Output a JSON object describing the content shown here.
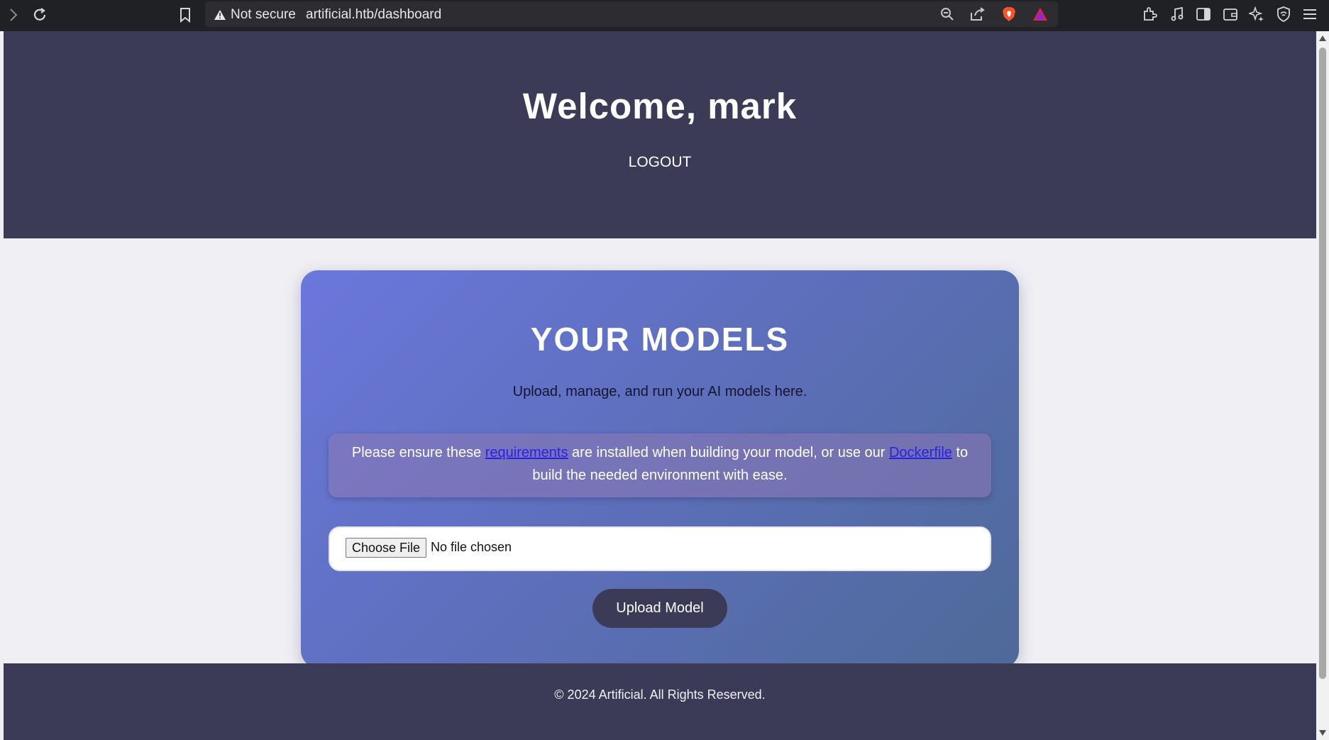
{
  "browser": {
    "security_label": "Not secure",
    "url": "artificial.htb/dashboard",
    "icons": [
      "forward-icon",
      "reload-icon",
      "bookmark-icon",
      "warning-icon",
      "zoom-icon",
      "share-icon",
      "brave-shield-icon",
      "brave-rewards-icon",
      "extensions-icon",
      "media-icon",
      "sidebar-icon",
      "wallet-icon",
      "leo-ai-icon",
      "vpn-icon",
      "menu-icon"
    ]
  },
  "header": {
    "title": "Welcome, mark",
    "logout_label": "LOGOUT"
  },
  "card": {
    "title": "YOUR MODELS",
    "subtitle": "Upload, manage, and run your AI models here.",
    "notice": {
      "text_before": "Please ensure these ",
      "link1": "requirements",
      "text_middle": " are installed when building your model, or use our ",
      "link2": "Dockerfile",
      "text_after": " to build the needed environment with ease."
    },
    "file_input": {
      "button_label": "Choose File",
      "status": "No file chosen"
    },
    "upload_label": "Upload Model"
  },
  "footer": {
    "text": "© 2024 Artificial. All Rights Reserved."
  },
  "colors": {
    "header_bg": "#3b3a57",
    "page_bg": "#f0eff4",
    "card_gradient_start": "#6b77dc",
    "card_gradient_end": "#4e6a98",
    "link": "#2b1fe6"
  }
}
